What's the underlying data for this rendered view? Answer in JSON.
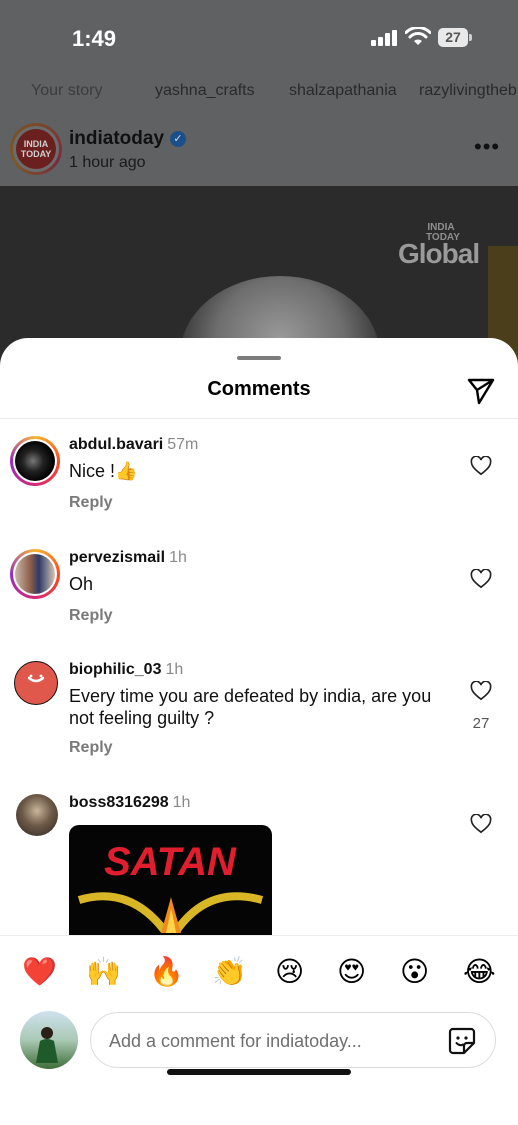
{
  "status_bar": {
    "time": "1:49",
    "battery": "27"
  },
  "stories": [
    {
      "label": "Your story"
    },
    {
      "label": "yashna_crafts"
    },
    {
      "label": "shalzapathania"
    },
    {
      "label": "razylivingtheb"
    }
  ],
  "post": {
    "username": "indiatoday",
    "time": "1 hour ago",
    "avatar_text": "INDIA TODAY",
    "image_logo_top": "INDIA TODAY",
    "image_logo_word": "Global"
  },
  "sheet": {
    "title": "Comments"
  },
  "comments": [
    {
      "user": "abdul.bavari",
      "time": "57m",
      "text": "Nice !👍",
      "reply": "Reply",
      "likes": ""
    },
    {
      "user": "pervezismail",
      "time": "1h",
      "text": "Oh",
      "reply": "Reply",
      "likes": ""
    },
    {
      "user": "biophilic_03",
      "time": "1h",
      "text": "Every time you are defeated by india,  are you not feeling  guilty ?",
      "reply": "Reply",
      "likes": "27"
    },
    {
      "user": "boss8316298",
      "time": "1h",
      "image_text": "SATAN"
    }
  ],
  "emoji_bar": [
    "❤️",
    "🙌",
    "🔥",
    "👏",
    "😢",
    "😍",
    "😮",
    "😂"
  ],
  "input": {
    "placeholder": "Add a comment for indiatoday..."
  },
  "colors": {
    "story_ring": "#d62976",
    "accent": "#000000"
  }
}
